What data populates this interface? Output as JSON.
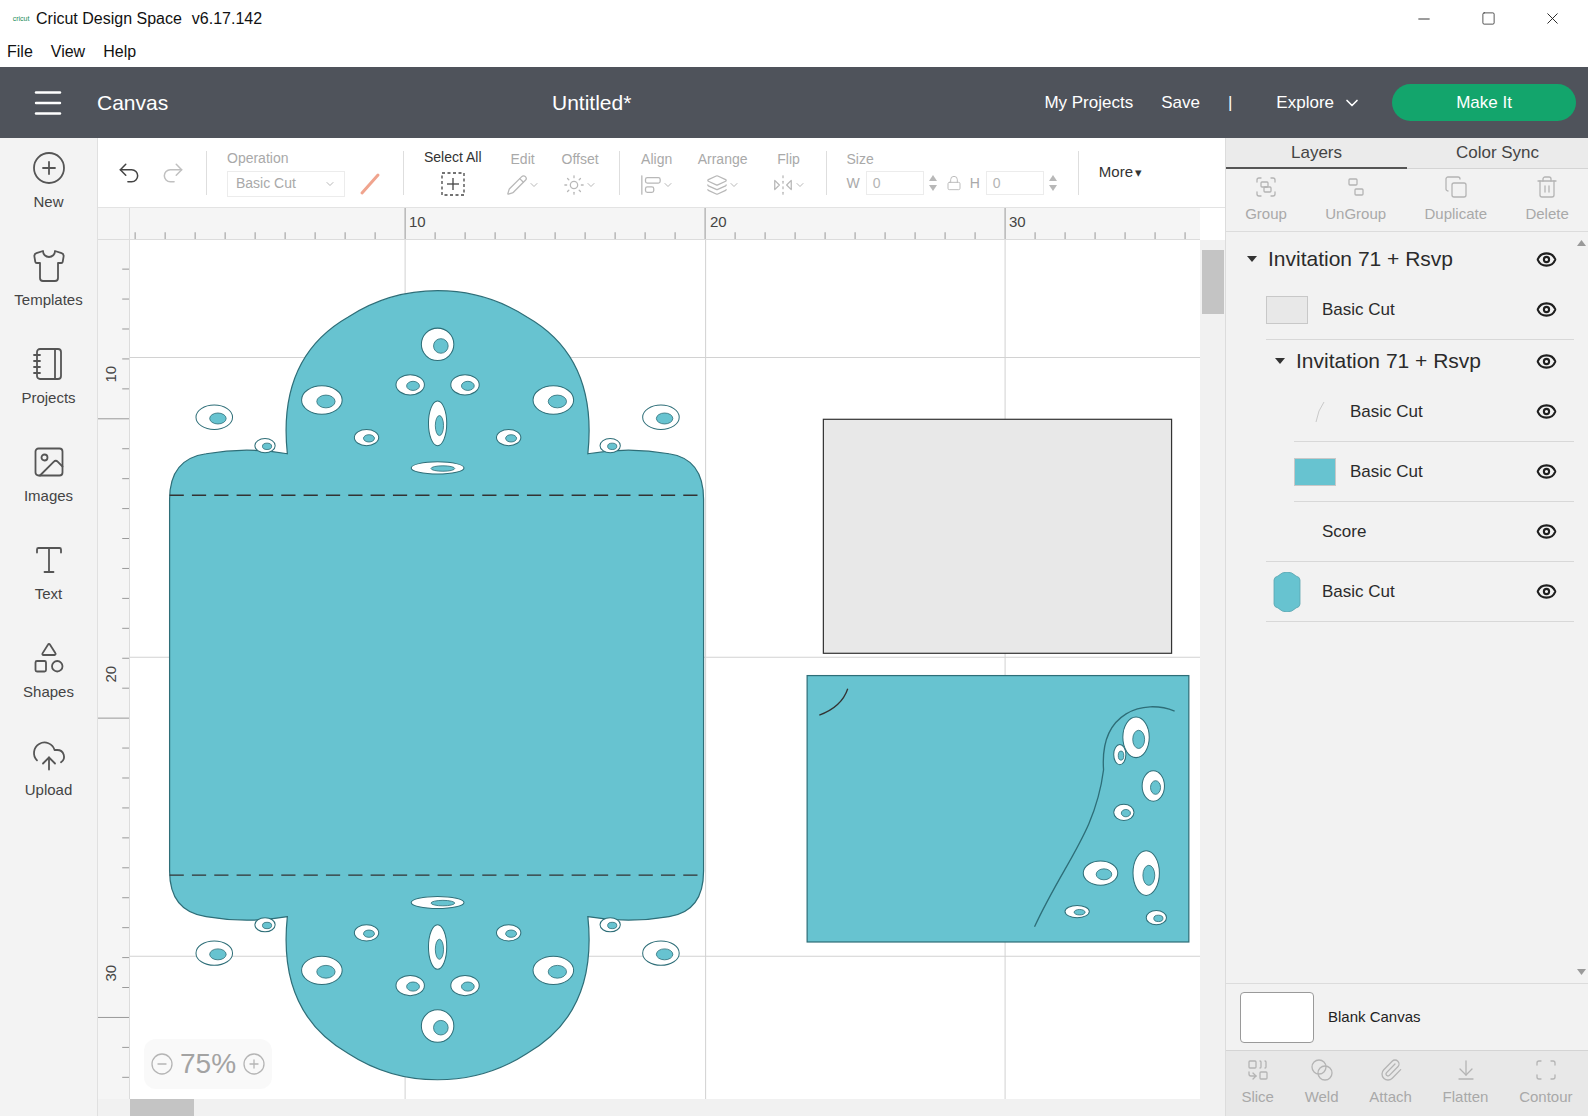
{
  "window": {
    "logo": "cricut",
    "title": "Cricut Design Space",
    "version": "v6.17.142"
  },
  "menu": [
    "File",
    "View",
    "Help"
  ],
  "header": {
    "section": "Canvas",
    "document": "Untitled*",
    "links": [
      "My Projects",
      "Save"
    ],
    "separator": "|",
    "explore": "Explore",
    "make_it": "Make It"
  },
  "sidebar": {
    "items": [
      {
        "label": "New"
      },
      {
        "label": "Templates"
      },
      {
        "label": "Projects"
      },
      {
        "label": "Images"
      },
      {
        "label": "Text"
      },
      {
        "label": "Shapes"
      },
      {
        "label": "Upload"
      }
    ]
  },
  "toolbar": {
    "undo": {
      "disabled": false
    },
    "redo": {
      "disabled": true
    },
    "operation": {
      "label": "Operation",
      "value": "Basic Cut",
      "disabled": true
    },
    "select_all": {
      "label": "Select All",
      "disabled": false
    },
    "edit_tools": [
      {
        "label": "Edit",
        "disabled": true
      },
      {
        "label": "Offset",
        "disabled": true
      }
    ],
    "arrange_tools": [
      {
        "label": "Align",
        "disabled": true
      },
      {
        "label": "Arrange",
        "disabled": true
      },
      {
        "label": "Flip",
        "disabled": true
      }
    ],
    "size": {
      "label": "Size",
      "w_label": "W",
      "w": "0",
      "h_label": "H",
      "h": "0",
      "locked": true,
      "disabled": true
    },
    "more": {
      "label": "More",
      "arrow": "▾"
    }
  },
  "rulers": {
    "top": [
      "10",
      "20",
      "30"
    ],
    "left": [
      "10",
      "20",
      "30"
    ]
  },
  "zoom": {
    "value": "75%"
  },
  "panel": {
    "tabs": [
      {
        "label": "Layers",
        "selected": true
      },
      {
        "label": "Color Sync",
        "selected": false
      }
    ],
    "actions": [
      {
        "label": "Group",
        "disabled": true
      },
      {
        "label": "UnGroup",
        "disabled": true
      },
      {
        "label": "Duplicate",
        "disabled": true
      },
      {
        "label": "Delete",
        "disabled": true
      }
    ],
    "layers": [
      {
        "kind": "group",
        "label": "Invitation 71 + Rsvp",
        "depth": 0,
        "expanded": true,
        "visible": true,
        "selected": false
      },
      {
        "kind": "layer",
        "label": "Basic Cut",
        "depth": 1,
        "thumb": "rect",
        "color": "#e8e8e8",
        "visible": true,
        "selected": false
      },
      {
        "kind": "group",
        "label": "Invitation 71 + Rsvp",
        "depth": 1,
        "expanded": true,
        "visible": true,
        "selected": false
      },
      {
        "kind": "layer",
        "label": "Basic Cut",
        "depth": 2,
        "thumb": "line",
        "visible": true,
        "selected": false
      },
      {
        "kind": "layer",
        "label": "Basic Cut",
        "depth": 2,
        "thumb": "rect",
        "color": "#67c3d0",
        "visible": true,
        "selected": false
      },
      {
        "kind": "layer",
        "label": "Score",
        "depth": 1,
        "thumb": "none",
        "visible": true,
        "selected": false
      },
      {
        "kind": "layer",
        "label": "Basic Cut",
        "depth": 1,
        "thumb": "invite",
        "color": "#67c3d0",
        "visible": true,
        "selected": false
      }
    ],
    "canvas": {
      "label": "Blank Canvas"
    },
    "bottom_actions": [
      {
        "label": "Slice",
        "disabled": true
      },
      {
        "label": "Weld",
        "disabled": true
      },
      {
        "label": "Attach",
        "disabled": true
      },
      {
        "label": "Flatten",
        "disabled": true
      },
      {
        "label": "Contour",
        "disabled": true
      }
    ]
  }
}
